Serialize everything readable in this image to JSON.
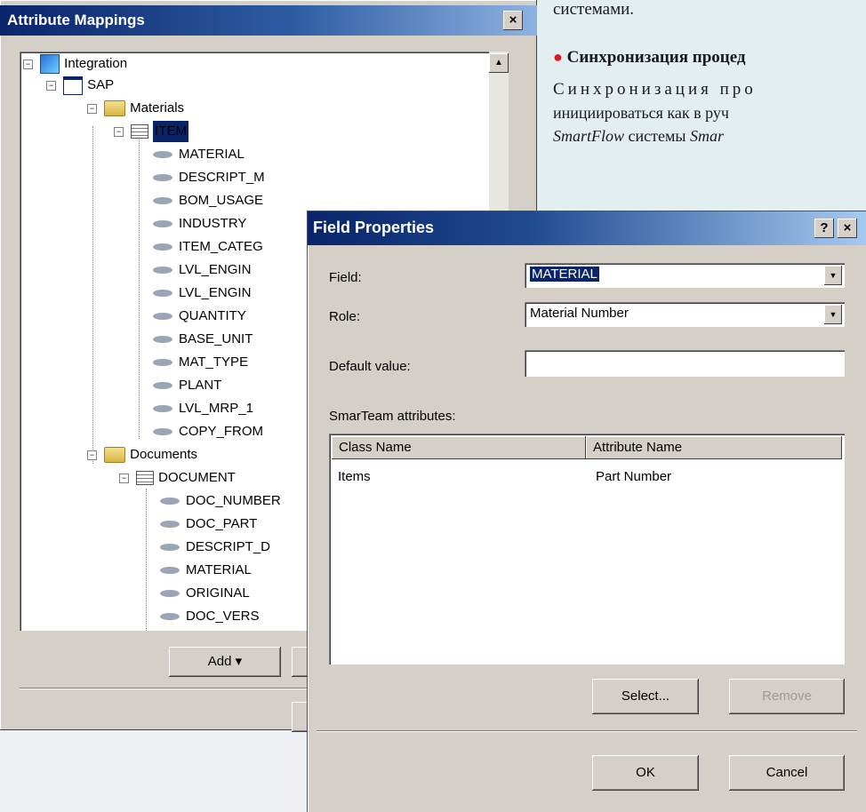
{
  "article": {
    "line1": "системами.",
    "bullet_title": "Синхронизация процед",
    "line3": "Синхронизация  про",
    "line4": "инициироваться как в руч",
    "line5_italic": "SmartFlow",
    "line5_normal": " системы ",
    "line5_italic2": "Smar",
    "bullet_color": "#d8191f"
  },
  "attribute_mappings": {
    "title": "Attribute Mappings",
    "close_glyph": "×",
    "tree": {
      "root": "Integration",
      "system": "SAP",
      "groups": [
        {
          "label": "Materials",
          "table": "ITEM",
          "fields": [
            "MATERIAL",
            "DESCRIPT_M",
            "BOM_USAGE",
            "INDUSTRY",
            "ITEM_CATEG",
            "LVL_ENGIN",
            "LVL_ENGIN",
            "QUANTITY",
            "BASE_UNIT",
            "MAT_TYPE",
            "PLANT",
            "LVL_MRP_1",
            "COPY_FROM"
          ]
        },
        {
          "label": "Documents",
          "table": "DOCUMENT",
          "fields": [
            "DOC_NUMBER",
            "DOC_PART",
            "DESCRIPT_D",
            "MATERIAL",
            "ORIGINAL",
            "DOC_VERS"
          ]
        }
      ]
    },
    "add_button": "Add ▾"
  },
  "field_properties": {
    "title": "Field Properties",
    "help_glyph": "?",
    "close_glyph": "×",
    "field_label": "Field:",
    "field_value": "MATERIAL",
    "role_label": "Role:",
    "role_value": "Material Number",
    "default_label": "Default value:",
    "default_value": "",
    "attributes_label": "SmarTeam attributes:",
    "columns": [
      "Class Name",
      "Attribute Name"
    ],
    "rows": [
      {
        "class_name": "Items",
        "attribute_name": "Part Number"
      }
    ],
    "select_button": "Select...",
    "remove_button": "Remove",
    "ok_button": "OK",
    "cancel_button": "Cancel"
  }
}
